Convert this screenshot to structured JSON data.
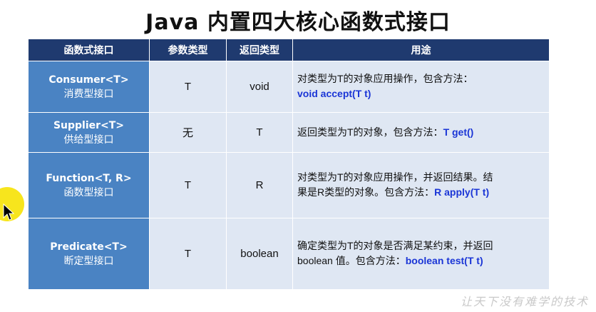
{
  "title": "Java 内置四大核心函数式接口",
  "headers": [
    "函数式接口",
    "参数类型",
    "返回类型",
    "用途"
  ],
  "rows": [
    {
      "name": "Consumer<T>",
      "type_label": "消费型接口",
      "param": "T",
      "ret": "void",
      "usage_lines": [
        "对类型为T的对象应用操作，包含方法："
      ],
      "usage_prefix2": "",
      "usage_code": "void accept(T t)"
    },
    {
      "name": "Supplier<T>",
      "type_label": "供给型接口",
      "param": "无",
      "ret": "T",
      "usage_lines": [
        "返回类型为T的对象，包含方法："
      ],
      "usage_prefix2": "",
      "usage_code": "T get()"
    },
    {
      "name": "Function<T, R>",
      "type_label": "函数型接口",
      "param": "T",
      "ret": "R",
      "usage_lines": [
        "对类型为T的对象应用操作，并返回结果。结"
      ],
      "usage_prefix2": "果是R类型的对象。包含方法：",
      "usage_code": "R apply(T t)"
    },
    {
      "name": "Predicate<T>",
      "type_label": "断定型接口",
      "param": "T",
      "ret": "boolean",
      "usage_lines": [
        "确定类型为T的对象是否满足某约束，并返回"
      ],
      "usage_prefix2": "boolean 值。包含方法：",
      "usage_code": "boolean test(T t)"
    }
  ],
  "watermark": "让天下没有难学的技术",
  "colors": {
    "header_bg": "#1f3a6f",
    "name_cell_bg": "#4a83c3",
    "body_cell_bg": "#dfe7f3",
    "code_text": "#1a35d6",
    "cursor_highlight": "#f7e51d"
  },
  "icons": {
    "cursor": "mouse-pointer-icon"
  }
}
